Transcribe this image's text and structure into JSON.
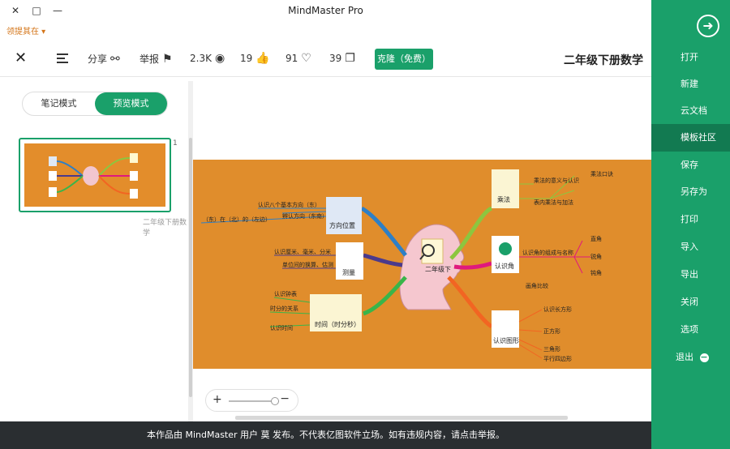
{
  "window": {
    "title": "MindMaster Pro"
  },
  "promo": {
    "text": "领提其在 ▾"
  },
  "toolbar": {
    "close_icon": "close-icon",
    "share_label": "分享",
    "report_label": "举报",
    "views_count": "2.3K",
    "likes_count": "19",
    "favorites_count": "91",
    "clones_count": "39",
    "clone_button": "克隆（免费）",
    "doc_title": "二年级下册数学"
  },
  "left_panel": {
    "mode_notes": "笔记模式",
    "mode_preview": "预览模式",
    "page_number": "1",
    "thumb_label": "二年级下册数学"
  },
  "mindmap": {
    "central": "二年级下",
    "branches": [
      {
        "label": "测量",
        "leaves": [
          "认识厘米、毫米、分米",
          "单位间的换算、估测"
        ]
      },
      {
        "label": "方向位置",
        "leaves": [
          "认识八个基本方向（东）",
          "（东）在（北）的（左边）",
          "辨认方向（东南）"
        ]
      },
      {
        "label": "时间（时分秒）",
        "leaves": [
          "认识钟表",
          "时分的关系",
          "认识时间"
        ]
      },
      {
        "label": "乘法",
        "leaves": [
          "乘法的意义与认识",
          "乘法口诀",
          "表内乘法与加法"
        ]
      },
      {
        "label": "认识角",
        "leaves": [
          "认识角的组成与名称",
          "直角",
          "锐角",
          "钝角",
          "画角比较"
        ]
      },
      {
        "label": "认识图形",
        "leaves": [
          "认识长方形",
          "正方形",
          "三角形",
          "平行四边形"
        ]
      }
    ]
  },
  "zoom": {
    "plus": "+",
    "minus": "−"
  },
  "footer": {
    "text": "本作品由 MindMaster 用户 莫 发布。不代表亿图软件立场。如有违规内容，请点击举报。"
  },
  "sidebar": {
    "back_icon": "arrow-right-circle-icon",
    "items": [
      "打开",
      "新建",
      "云文档",
      "模板社区",
      "保存",
      "另存为",
      "打印",
      "导入",
      "导出",
      "关闭",
      "选项",
      "退出"
    ]
  }
}
